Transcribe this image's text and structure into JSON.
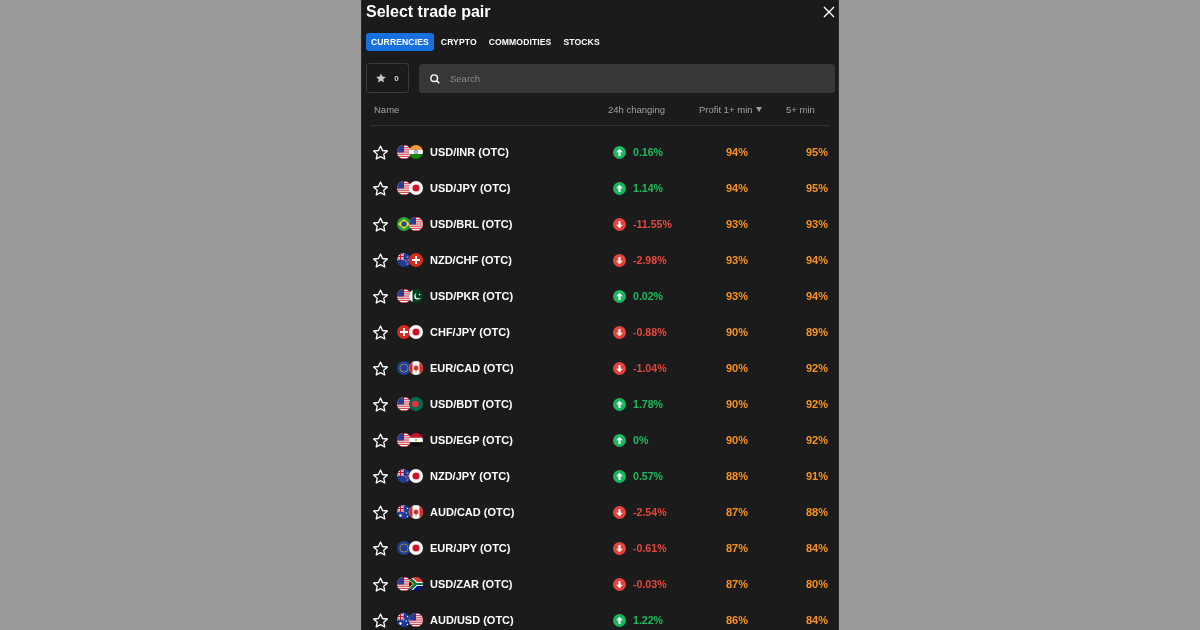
{
  "title": "Select trade pair",
  "tabs": [
    {
      "label": "CURRENCIES",
      "selected": true
    },
    {
      "label": "CRYPTO",
      "selected": false
    },
    {
      "label": "COMMODITIES",
      "selected": false
    },
    {
      "label": "STOCKS",
      "selected": false
    }
  ],
  "favorites_filter": {
    "count": "0"
  },
  "search": {
    "placeholder": "Search"
  },
  "columns": [
    {
      "label": "Name",
      "sorted": false
    },
    {
      "label": "24h changing",
      "sorted": false
    },
    {
      "label": "Profit 1+ min",
      "sorted": true
    },
    {
      "label": "5+ min",
      "sorted": false
    }
  ],
  "rows": [
    {
      "favorite": false,
      "flags": [
        {
          "kind": "us"
        },
        {
          "kind": "in"
        }
      ],
      "name": "USD/INR (OTC)",
      "kind": "up",
      "change": "0.16%",
      "profit_1min": "94%",
      "profit_5min": "95%"
    },
    {
      "favorite": false,
      "flags": [
        {
          "kind": "us"
        },
        {
          "kind": "jp"
        }
      ],
      "name": "USD/JPY (OTC)",
      "kind": "up",
      "change": "1.14%",
      "profit_1min": "94%",
      "profit_5min": "95%"
    },
    {
      "favorite": false,
      "flags": [
        {
          "kind": "br"
        },
        {
          "kind": "us"
        }
      ],
      "name": "USD/BRL (OTC)",
      "kind": "down",
      "change": "-11.55%",
      "profit_1min": "93%",
      "profit_5min": "93%"
    },
    {
      "favorite": false,
      "flags": [
        {
          "kind": "nz"
        },
        {
          "kind": "ch"
        }
      ],
      "name": "NZD/CHF (OTC)",
      "kind": "down",
      "change": "-2.98%",
      "profit_1min": "93%",
      "profit_5min": "94%"
    },
    {
      "favorite": false,
      "flags": [
        {
          "kind": "us"
        },
        {
          "kind": "pk"
        }
      ],
      "name": "USD/PKR (OTC)",
      "kind": "up",
      "change": "0.02%",
      "profit_1min": "93%",
      "profit_5min": "94%"
    },
    {
      "favorite": false,
      "flags": [
        {
          "kind": "ch"
        },
        {
          "kind": "jp"
        }
      ],
      "name": "CHF/JPY (OTC)",
      "kind": "down",
      "change": "-0.88%",
      "profit_1min": "90%",
      "profit_5min": "89%"
    },
    {
      "favorite": false,
      "flags": [
        {
          "kind": "eu"
        },
        {
          "kind": "ca"
        }
      ],
      "name": "EUR/CAD (OTC)",
      "kind": "down",
      "change": "-1.04%",
      "profit_1min": "90%",
      "profit_5min": "92%"
    },
    {
      "favorite": false,
      "flags": [
        {
          "kind": "us"
        },
        {
          "kind": "bd"
        }
      ],
      "name": "USD/BDT (OTC)",
      "kind": "up",
      "change": "1.78%",
      "profit_1min": "90%",
      "profit_5min": "92%"
    },
    {
      "favorite": false,
      "flags": [
        {
          "kind": "us"
        },
        {
          "kind": "eg"
        }
      ],
      "name": "USD/EGP (OTC)",
      "kind": "up",
      "change": "0%",
      "profit_1min": "90%",
      "profit_5min": "92%"
    },
    {
      "favorite": false,
      "flags": [
        {
          "kind": "nz"
        },
        {
          "kind": "jp"
        }
      ],
      "name": "NZD/JPY (OTC)",
      "kind": "up",
      "change": "0.57%",
      "profit_1min": "88%",
      "profit_5min": "91%"
    },
    {
      "favorite": false,
      "flags": [
        {
          "kind": "au"
        },
        {
          "kind": "ca"
        }
      ],
      "name": "AUD/CAD (OTC)",
      "kind": "down",
      "change": "-2.54%",
      "profit_1min": "87%",
      "profit_5min": "88%"
    },
    {
      "favorite": false,
      "flags": [
        {
          "kind": "eu"
        },
        {
          "kind": "jp"
        }
      ],
      "name": "EUR/JPY (OTC)",
      "kind": "down",
      "change": "-0.61%",
      "profit_1min": "87%",
      "profit_5min": "84%"
    },
    {
      "favorite": false,
      "flags": [
        {
          "kind": "us"
        },
        {
          "kind": "za"
        }
      ],
      "name": "USD/ZAR (OTC)",
      "kind": "down",
      "change": "-0.03%",
      "profit_1min": "87%",
      "profit_5min": "80%"
    },
    {
      "favorite": false,
      "flags": [
        {
          "kind": "au"
        },
        {
          "kind": "us"
        }
      ],
      "name": "AUD/USD (OTC)",
      "kind": "up",
      "change": "1.22%",
      "profit_1min": "86%",
      "profit_5min": "84%"
    }
  ]
}
